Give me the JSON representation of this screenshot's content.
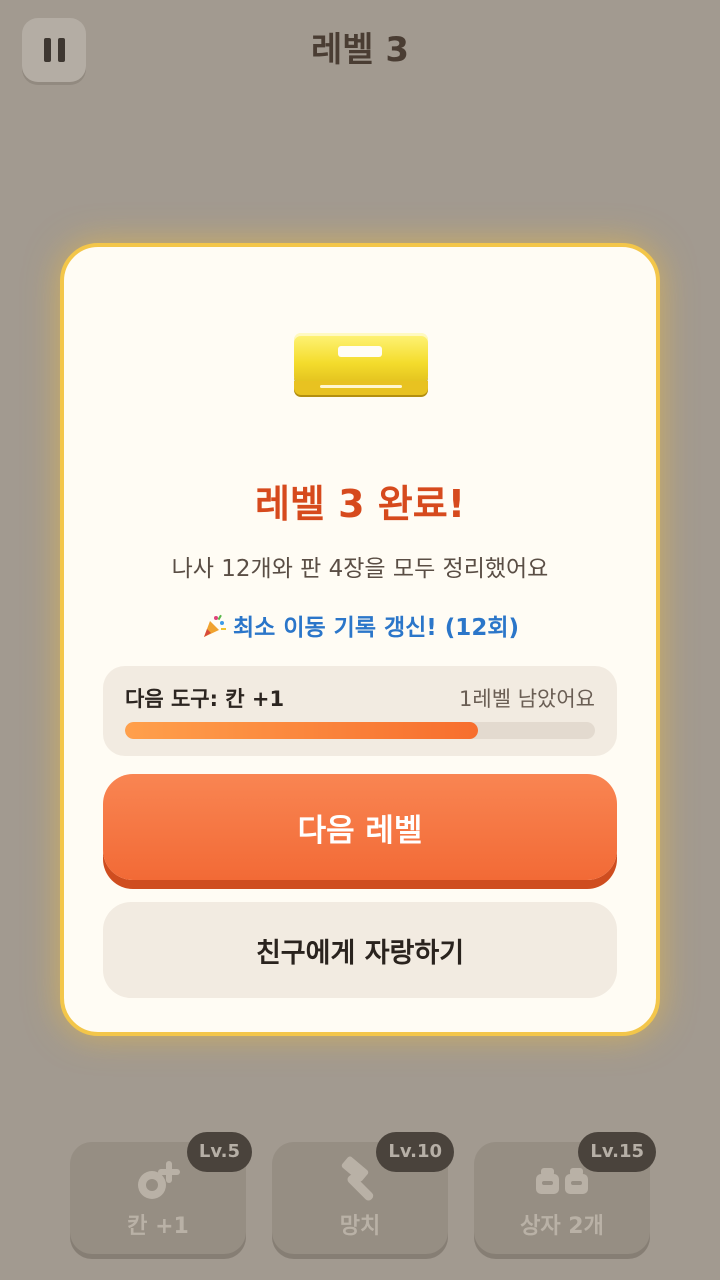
{
  "header": {
    "level_title": "레벨 3",
    "pause_icon": "pause-icon"
  },
  "modal": {
    "icon": "yellow-drawer-cabinet-icon",
    "title": "레벨 3 완료!",
    "summary": "나사 12개와 판 4장을 모두 정리했어요",
    "record_icon": "party-popper-icon",
    "record_text": "최소 이동 기록 갱신! (12회)",
    "progress": {
      "next_tool_label": "다음 도구: 칸 +1",
      "remaining_label": "1레벨 남았어요",
      "fill_fraction": 0.75
    },
    "next_button_label": "다음 레벨",
    "share_button_label": "친구에게 자랑하기"
  },
  "tools": [
    {
      "icon": "add-slot-icon",
      "label": "칸 +1",
      "level": "Lv.5"
    },
    {
      "icon": "hammer-icon",
      "label": "망치",
      "level": "Lv.10"
    },
    {
      "icon": "two-boxes-icon",
      "label": "상자 2개",
      "level": "Lv.15"
    }
  ],
  "colors": {
    "accent": "#f26a36",
    "title": "#d64a1d",
    "record": "#2b76c9",
    "modal_border": "#f3c64a"
  }
}
